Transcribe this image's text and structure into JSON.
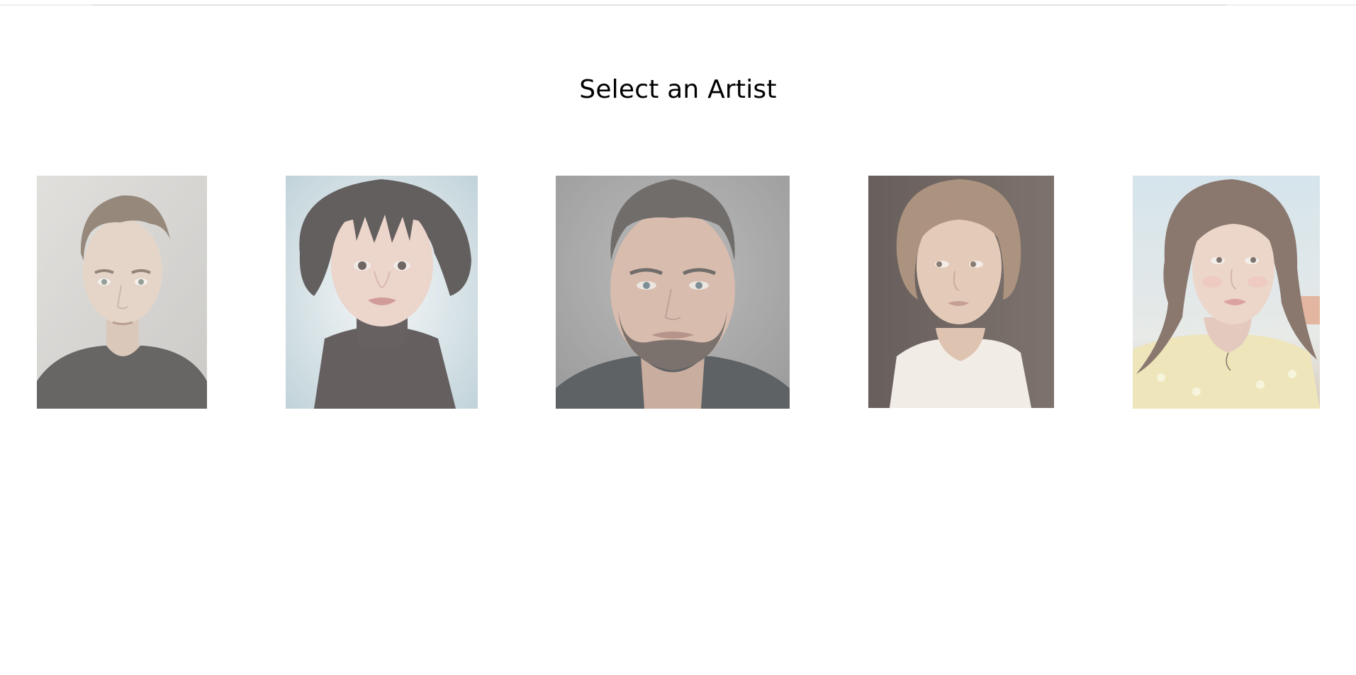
{
  "page": {
    "title": "Select an Artist"
  },
  "artists": [
    {
      "id": "artist-1",
      "portrait": "young-man-portrait",
      "colors": {
        "bg": "#c9c7c3",
        "hair": "#6b5a48",
        "skin": "#d9c2b0",
        "shirt": "#2e2c2b"
      }
    },
    {
      "id": "artist-2",
      "portrait": "woman-bob-portrait",
      "colors": {
        "bg": "#d8e2e6",
        "hair": "#2a2423",
        "skin": "#e2c2b6",
        "shirt": "#2b2223"
      }
    },
    {
      "id": "artist-3",
      "portrait": "bearded-man-portrait",
      "colors": {
        "bg": "#8d8d8d",
        "hair": "#3a3633",
        "skin": "#c9a38e",
        "shirt": "#232629"
      }
    },
    {
      "id": "artist-4",
      "portrait": "woman-dark-background-portrait",
      "colors": {
        "bg": "#3d302b",
        "hair": "#8f6c4f",
        "skin": "#d8b59c",
        "shirt": "#ebe4da"
      }
    },
    {
      "id": "artist-5",
      "portrait": "woman-sky-portrait",
      "colors": {
        "bg": "#b8d0dc",
        "hair": "#5a4236",
        "skin": "#e4c3b4",
        "shirt": "#e8dca0"
      }
    }
  ]
}
